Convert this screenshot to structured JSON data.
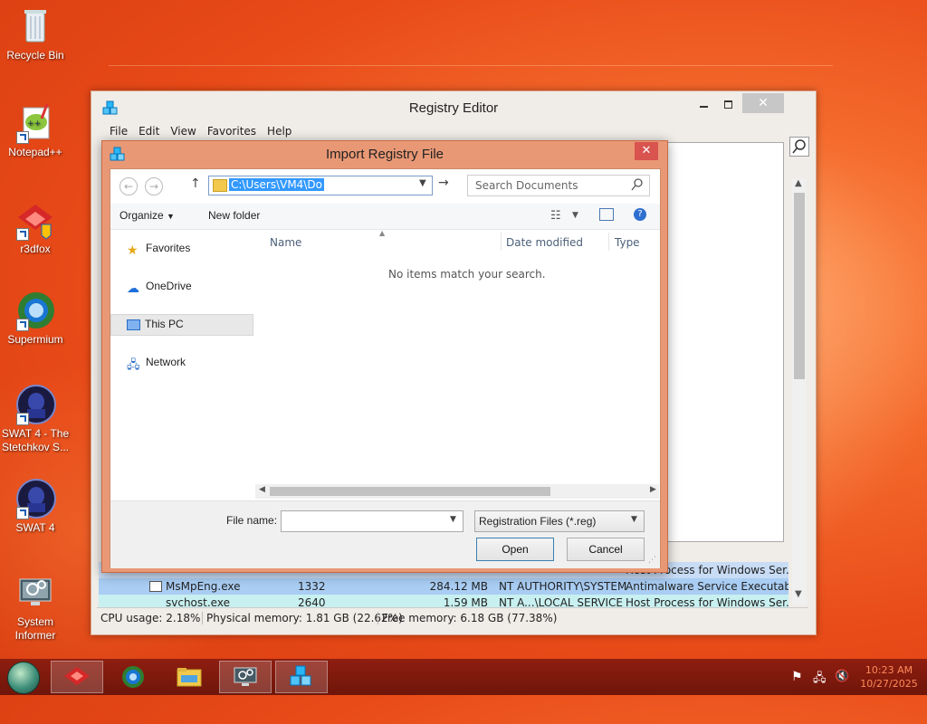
{
  "desktop": {
    "icons": [
      {
        "label": "Recycle Bin",
        "icon": "recycle-bin-icon"
      },
      {
        "label": "Notepad++",
        "icon": "notepad-plus-plus-icon"
      },
      {
        "label": "r3dfox",
        "icon": "r3dfox-icon"
      },
      {
        "label": "Supermium",
        "icon": "supermium-icon"
      },
      {
        "label": "SWAT 4 - The Stetchkov S...",
        "icon": "swat4-expansion-icon"
      },
      {
        "label": "SWAT 4",
        "icon": "swat4-icon"
      },
      {
        "label": "System Informer",
        "icon": "system-informer-icon"
      }
    ]
  },
  "registry_editor": {
    "title": "Registry Editor",
    "menu": [
      "File",
      "Edit",
      "View",
      "Favorites",
      "Help"
    ]
  },
  "task_manager": {
    "rows": [
      {
        "name": "",
        "pid": "",
        "memory": "",
        "user": "",
        "description": "Host Process for Windows Ser..."
      },
      {
        "name": "MsMpEng.exe",
        "pid": "1332",
        "memory": "284.12 MB",
        "user": "NT AUTHORITY\\SYSTEM",
        "description": "Antimalware Service Executable"
      },
      {
        "name": "svchost.exe",
        "pid": "2640",
        "memory": "1.59 MB",
        "user": "NT A...\\LOCAL SERVICE",
        "description": "Host Process for Windows Ser..."
      }
    ],
    "status": {
      "cpu": "CPU usage: 2.18%",
      "physical": "Physical memory: 1.81 GB (22.62%)",
      "free": "Free memory: 6.18 GB (77.38%)"
    }
  },
  "dialog": {
    "title": "Import Registry File",
    "address": "C:\\Users\\VM4\\Do",
    "search_placeholder": "Search Documents",
    "organize": "Organize",
    "new_folder": "New folder",
    "nav": {
      "favorites": "Favorites",
      "onedrive": "OneDrive",
      "thispc": "This PC",
      "network": "Network"
    },
    "columns": {
      "name": "Name",
      "date": "Date modified",
      "type": "Type"
    },
    "empty_message": "No items match your search.",
    "filename_label": "File name:",
    "filename_value": "",
    "filetype": "Registration Files (*.reg)",
    "open": "Open",
    "cancel": "Cancel"
  },
  "taskbar": {
    "apps": [
      "r3dfox",
      "Supermium",
      "File Explorer",
      "System Informer",
      "Registry Editor"
    ],
    "time": "10:23 AM",
    "date": "10/27/2025"
  },
  "colors": {
    "accent": "#e99875",
    "taskbar": "#7a180c",
    "selection": "#3399ff"
  }
}
